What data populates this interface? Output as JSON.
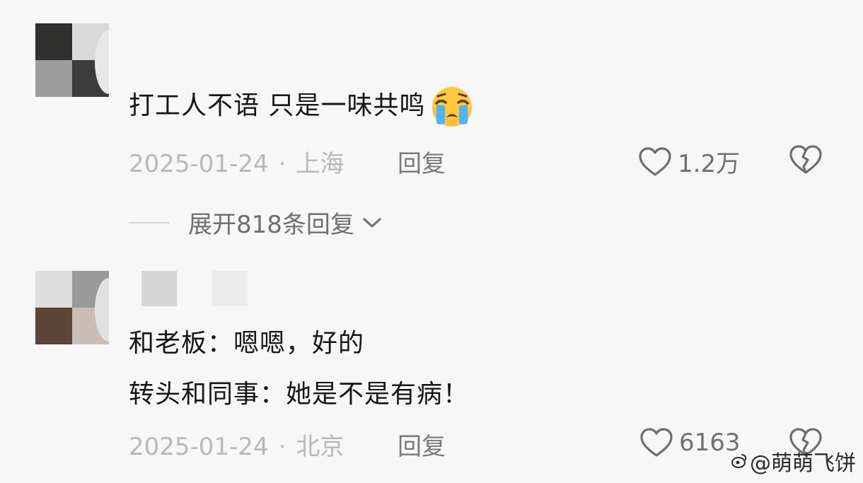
{
  "comments": [
    {
      "text_lines": [
        "打工人不语 只是一味共鸣"
      ],
      "emoji": "loudly-crying-face",
      "date": "2025-01-24",
      "separator": "·",
      "location": "上海",
      "reply_label": "回复",
      "likes": "1.2万",
      "expand_replies_label": "展开818条回复"
    },
    {
      "text_lines": [
        "和老板：嗯嗯，好的",
        "转头和同事：她是不是有病！"
      ],
      "date": "2025-01-24",
      "separator": "·",
      "location": "北京",
      "reply_label": "回复",
      "likes": "6163"
    }
  ],
  "watermark": {
    "text": "@萌萌飞饼",
    "icon": "weibo-logo"
  },
  "colors": {
    "background": "#f7f7f7",
    "text_primary": "#161616",
    "text_meta": "#b8b8b8",
    "text_secondary": "#707070"
  }
}
